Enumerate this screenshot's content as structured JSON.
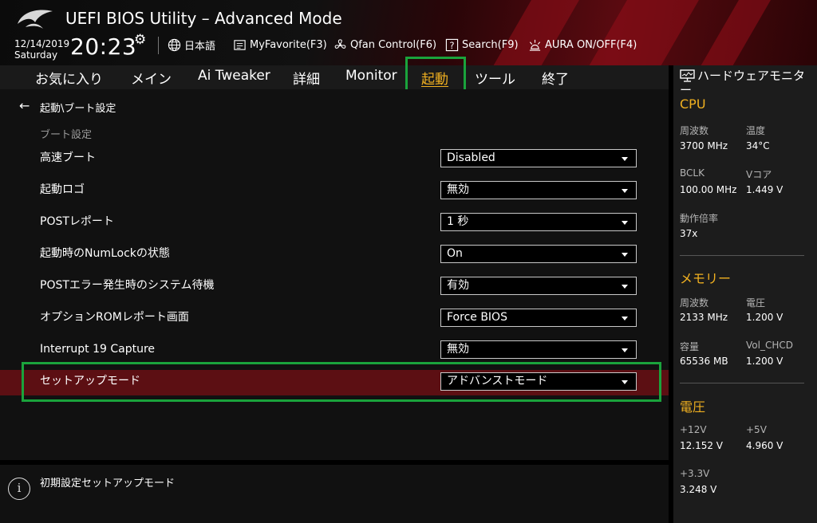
{
  "header": {
    "title": "UEFI BIOS Utility – Advanced Mode",
    "date": "12/14/2019",
    "weekday": "Saturday",
    "time": "20:23",
    "language": "日本語",
    "my_favorite": "MyFavorite(F3)",
    "qfan": "Qfan Control(F6)",
    "search": "Search(F9)",
    "aura": "AURA ON/OFF(F4)"
  },
  "tabs": [
    {
      "label": "お気に入り",
      "active": false
    },
    {
      "label": "メイン",
      "active": false
    },
    {
      "label": "Ai Tweaker",
      "active": false
    },
    {
      "label": "詳細",
      "active": false
    },
    {
      "label": "Monitor",
      "active": false
    },
    {
      "label": "起動",
      "active": true
    },
    {
      "label": "ツール",
      "active": false
    },
    {
      "label": "終了",
      "active": false
    }
  ],
  "main": {
    "breadcrumb": "起動\\ブート設定",
    "section": "ブート設定",
    "settings": [
      {
        "label": "高速ブート",
        "value": "Disabled"
      },
      {
        "label": "起動ロゴ",
        "value": "無効"
      },
      {
        "label": "POSTレポート",
        "value": "1 秒"
      },
      {
        "label": "起動時のNumLockの状態",
        "value": "On"
      },
      {
        "label": "POSTエラー発生時のシステム待機",
        "value": "有効"
      },
      {
        "label": "オプションROMレポート画面",
        "value": "Force BIOS"
      },
      {
        "label": "Interrupt 19 Capture",
        "value": "無効"
      },
      {
        "label": "セットアップモード",
        "value": "アドバンストモード"
      }
    ]
  },
  "help": {
    "text": "初期設定セットアップモード"
  },
  "hw_monitor": {
    "title": "ハードウェアモニター",
    "cpu": {
      "heading": "CPU",
      "freq_label": "周波数",
      "freq": "3700 MHz",
      "temp_label": "温度",
      "temp": "34°C",
      "bclk_label": "BCLK",
      "bclk": "100.00 MHz",
      "vcore_label": "Vコア",
      "vcore": "1.449 V",
      "ratio_label": "動作倍率",
      "ratio": "37x"
    },
    "memory": {
      "heading": "メモリー",
      "freq_label": "周波数",
      "freq": "2133 MHz",
      "volt_label": "電圧",
      "volt": "1.200 V",
      "cap_label": "容量",
      "cap": "65536 MB",
      "vol_chcd_label": "Vol_CHCD",
      "vol_chcd": "1.200 V"
    },
    "voltage": {
      "heading": "電圧",
      "v12_label": "+12V",
      "v12": "12.152 V",
      "v5_label": "+5V",
      "v5": "4.960 V",
      "v33_label": "+3.3V",
      "v33": "3.248 V"
    }
  },
  "colors": {
    "accent": "#f0b020",
    "highlight_row": "#5c0f13",
    "annotation_box": "#1aa33c"
  }
}
